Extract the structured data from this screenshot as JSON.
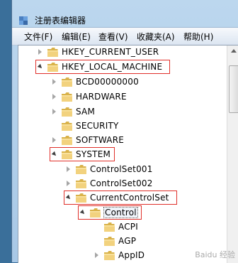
{
  "window": {
    "title": "注册表编辑器"
  },
  "menu": [
    "文件(F)",
    "编辑(E)",
    "查看(V)",
    "收藏夹(A)",
    "帮助(H)"
  ],
  "tree": [
    {
      "label": "HKEY_CURRENT_USER",
      "state": "collapsed",
      "highlighted": false,
      "selected": false
    },
    {
      "label": "HKEY_LOCAL_MACHINE",
      "state": "expanded",
      "highlighted": true,
      "selected": false
    },
    {
      "label": "BCD00000000",
      "state": "collapsed",
      "highlighted": false,
      "selected": false
    },
    {
      "label": "HARDWARE",
      "state": "collapsed",
      "highlighted": false,
      "selected": false
    },
    {
      "label": "SAM",
      "state": "collapsed",
      "highlighted": false,
      "selected": false
    },
    {
      "label": "SECURITY",
      "state": "none",
      "highlighted": false,
      "selected": false
    },
    {
      "label": "SOFTWARE",
      "state": "collapsed",
      "highlighted": false,
      "selected": false
    },
    {
      "label": "SYSTEM",
      "state": "expanded",
      "highlighted": true,
      "selected": false
    },
    {
      "label": "ControlSet001",
      "state": "collapsed",
      "highlighted": false,
      "selected": false
    },
    {
      "label": "ControlSet002",
      "state": "collapsed",
      "highlighted": false,
      "selected": false
    },
    {
      "label": "CurrentControlSet",
      "state": "expanded",
      "highlighted": true,
      "selected": false
    },
    {
      "label": "Control",
      "state": "expanded",
      "highlighted": true,
      "selected": true
    },
    {
      "label": "ACPI",
      "state": "none",
      "highlighted": false,
      "selected": false
    },
    {
      "label": "AGP",
      "state": "none",
      "highlighted": false,
      "selected": false
    },
    {
      "label": "AppID",
      "state": "collapsed",
      "highlighted": false,
      "selected": false
    }
  ],
  "icons": {
    "app": "registry-editor-icon",
    "folder": "folder-icon"
  },
  "colors": {
    "highlight_box": "#e0302a",
    "folder": "#e9c56a"
  },
  "watermark": "Baidu 经验"
}
